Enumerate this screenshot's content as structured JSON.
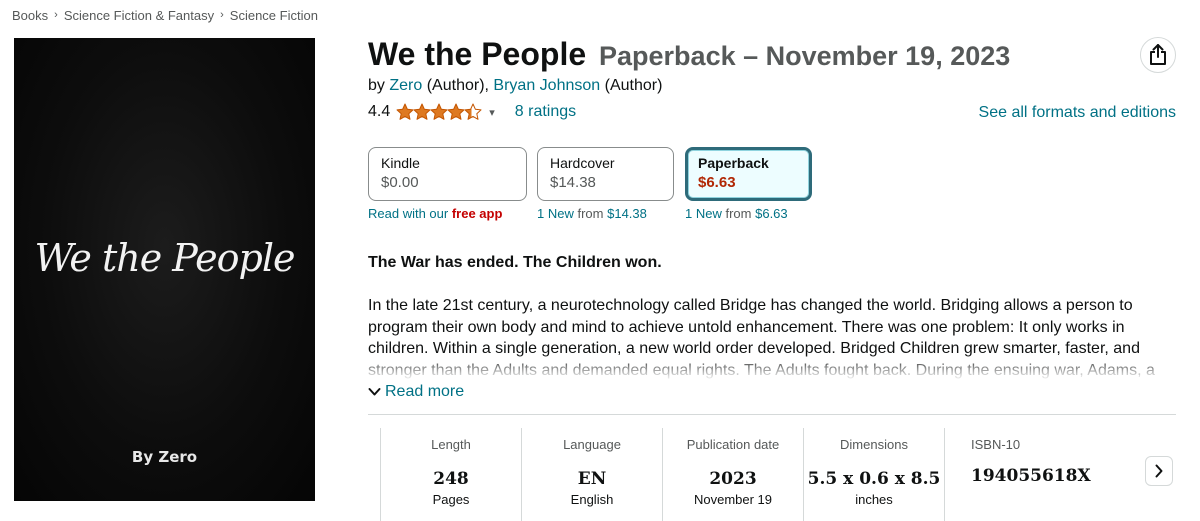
{
  "breadcrumb": [
    "Books",
    "Science Fiction & Fantasy",
    "Science Fiction"
  ],
  "cover": {
    "title": "We the People",
    "author": "By Zero"
  },
  "product": {
    "title": "We the People",
    "format_date": "Paperback – November 19, 2023"
  },
  "byline": {
    "prefix": "by",
    "authors": [
      {
        "name": "Zero",
        "role": "(Author),"
      },
      {
        "name": "Bryan Johnson",
        "role": "(Author)"
      }
    ]
  },
  "rating": {
    "value": "4.4",
    "stars": 4.4,
    "count_label": "8 ratings"
  },
  "formats_link": "See all formats and editions",
  "formats": [
    {
      "name": "Kindle",
      "price": "$0.00",
      "selected": false,
      "sub": {
        "pre": "Read with our",
        "highlight": "free app"
      }
    },
    {
      "name": "Hardcover",
      "price": "$14.38",
      "selected": false,
      "sub": {
        "new": "1 New",
        "from": "from",
        "price": "$14.38"
      }
    },
    {
      "name": "Paperback",
      "price": "$6.63",
      "selected": true,
      "sub": {
        "new": "1 New",
        "from": "from",
        "price": "$6.63"
      }
    }
  ],
  "description": {
    "tagline": "The War has ended. The Children won.",
    "body": "In the late 21st century, a neurotechnology called Bridge has changed the world. Bridging allows a person to program their own body and mind to achieve untold enhancement. There was one problem: It only works in children. Within a single generation, a new world order developed. Bridged Children grew smarter, faster, and stronger than the Adults and demanded equal rights. The Adults fought back. During the ensuing war, Adams, a prodigy among the Children, hid",
    "read_more": "Read more"
  },
  "details": [
    {
      "label": "Length",
      "value": "248",
      "sub": "Pages"
    },
    {
      "label": "Language",
      "value": "EN",
      "sub": "English"
    },
    {
      "label": "Publication date",
      "value": "2023",
      "sub": "November 19"
    },
    {
      "label": "Dimensions",
      "value": "5.5 x 0.6 x 8.5",
      "sub": "inches"
    },
    {
      "label": "ISBN-10",
      "value": "194055618X",
      "sub": ""
    }
  ],
  "icons": {
    "share": "share-icon",
    "star": "star-icon",
    "caret": "chevron-down-icon",
    "read_more": "chevron-down-icon",
    "next": "chevron-right-icon"
  },
  "colors": {
    "link": "#007185",
    "star": "#de7921",
    "price_red": "#b12704",
    "selected_border": "#2e6b7a",
    "selected_bg": "#edfdff"
  }
}
